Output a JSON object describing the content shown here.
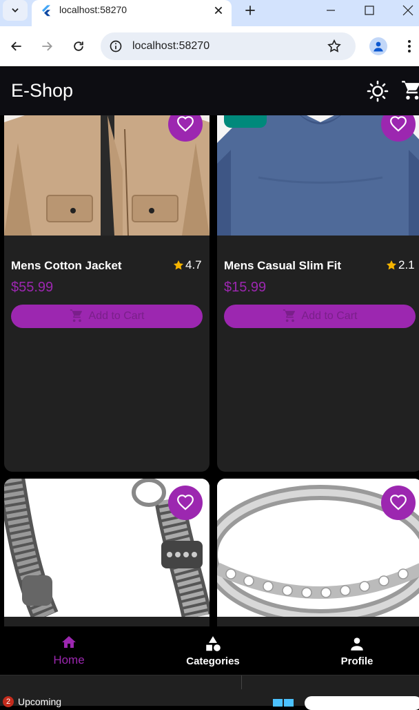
{
  "browser": {
    "tab_title": "localhost:58270",
    "address": "localhost:58270"
  },
  "app": {
    "title": "E-Shop"
  },
  "products": [
    {
      "name": "Mens Cotton Jacket",
      "rating": "4.7",
      "price": "$55.99",
      "add_label": "Add to Cart"
    },
    {
      "name": "Mens Casual Slim Fit",
      "rating": "2.1",
      "price": "$15.99",
      "add_label": "Add to Cart"
    }
  ],
  "nav": {
    "home": "Home",
    "categories": "Categories",
    "profile": "Profile"
  },
  "taskbar": {
    "badge_count": "2",
    "weather_label": "Upcoming"
  },
  "colors": {
    "accent": "#9c27b0",
    "badge": "#00897b",
    "card": "#212121",
    "star": "#f5b400"
  }
}
